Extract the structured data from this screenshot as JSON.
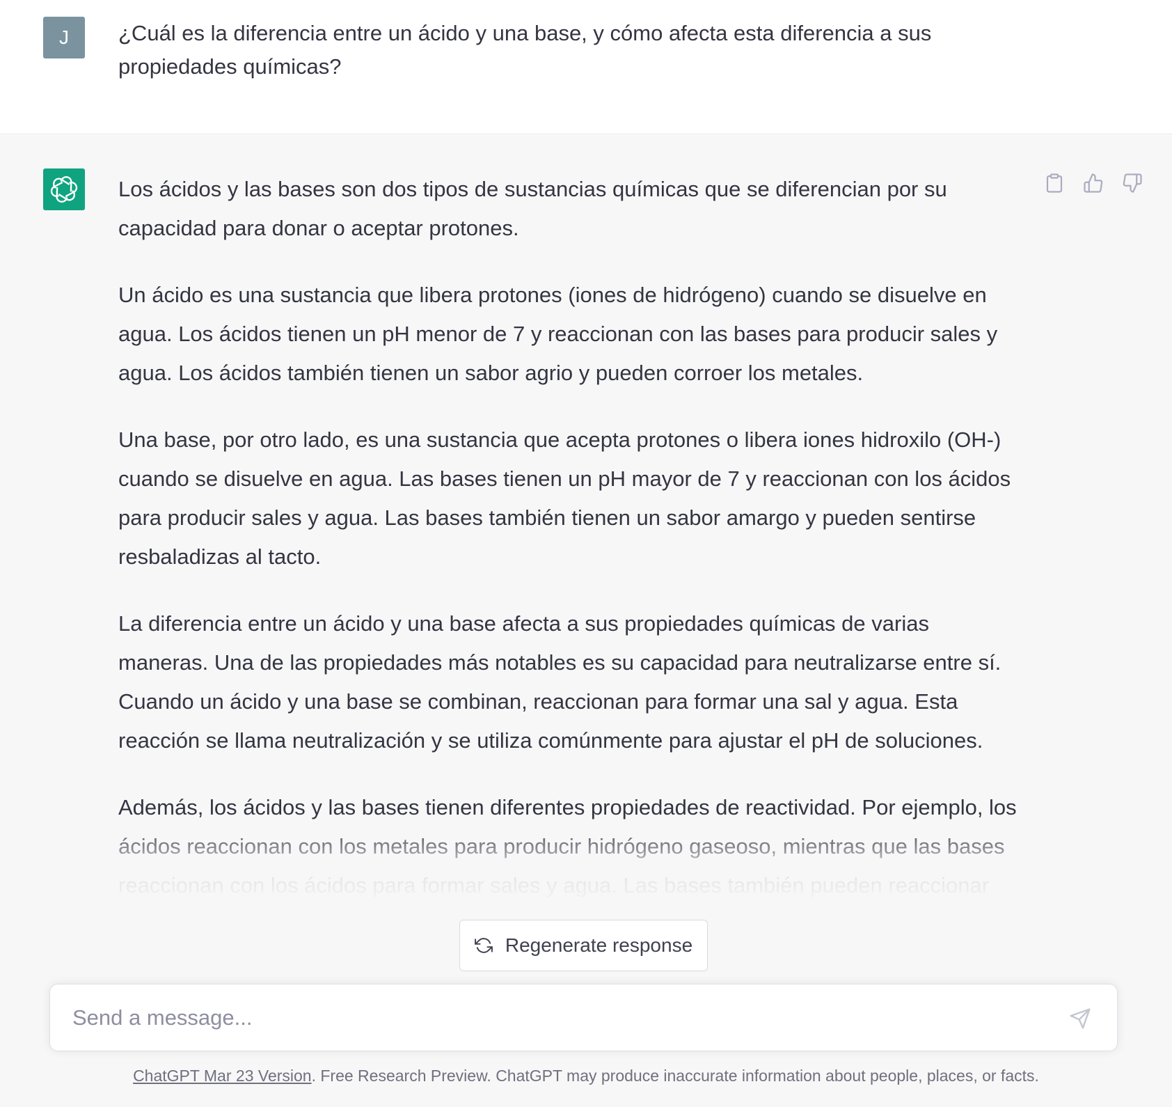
{
  "user_message": {
    "avatar_initial": "J",
    "text": "¿Cuál es la diferencia entre un ácido y una base, y cómo afecta esta diferencia a sus propiedades químicas?"
  },
  "assistant_message": {
    "paragraphs": [
      "Los ácidos y las bases son dos tipos de sustancias químicas que se diferencian por su capacidad para donar o aceptar protones.",
      "Un ácido es una sustancia que libera protones (iones de hidrógeno) cuando se disuelve en agua. Los ácidos tienen un pH menor de 7 y reaccionan con las bases para producir sales y agua. Los ácidos también tienen un sabor agrio y pueden corroer los metales.",
      "Una base, por otro lado, es una sustancia que acepta protones o libera iones hidroxilo (OH-) cuando se disuelve en agua. Las bases tienen un pH mayor de 7 y reaccionan con los ácidos para producir sales y agua. Las bases también tienen un sabor amargo y pueden sentirse resbaladizas al tacto.",
      "La diferencia entre un ácido y una base afecta a sus propiedades químicas de varias maneras. Una de las propiedades más notables es su capacidad para neutralizarse entre sí. Cuando un ácido y una base se combinan, reaccionan para formar una sal y agua. Esta reacción se llama neutralización y se utiliza comúnmente para ajustar el pH de soluciones.",
      "Además, los ácidos y las bases tienen diferentes propiedades de reactividad. Por ejemplo, los ácidos reaccionan con los metales para producir hidrógeno gaseoso, mientras que las bases reaccionan con los ácidos para formar sales y agua. Las bases también pueden reaccionar con los lípidos y proteínas en la piel, lo que puede causar irritación."
    ],
    "action_icons": [
      "clipboard-icon",
      "thumbs-up-icon",
      "thumbs-down-icon"
    ]
  },
  "regenerate": {
    "label": "Regenerate response",
    "icon": "refresh-icon"
  },
  "composer": {
    "placeholder": "Send a message...",
    "value": "",
    "send_icon": "send-icon"
  },
  "footer": {
    "link_text": "ChatGPT Mar 23 Version",
    "text": ". Free Research Preview. ChatGPT may produce inaccurate information about people, places, or facts."
  },
  "colors": {
    "user_avatar": "#7b939f",
    "assistant_avatar": "#10a37f",
    "assistant_bg": "#f7f7f8",
    "text": "#343541"
  }
}
